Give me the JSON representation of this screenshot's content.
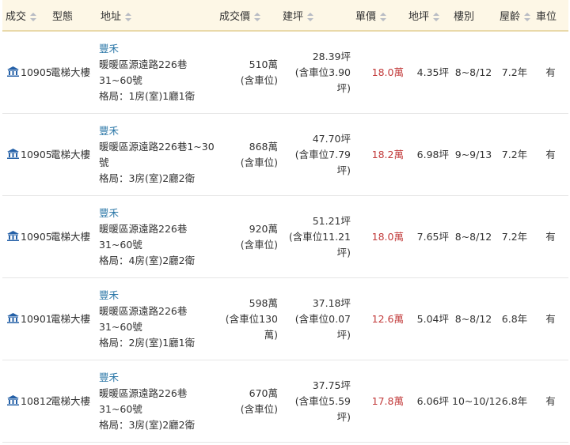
{
  "headers": [
    {
      "label": "成交",
      "sortable": true
    },
    {
      "label": "型態",
      "sortable": false
    },
    {
      "label": "地址",
      "sortable": true
    },
    {
      "label": "成交價",
      "sortable": true
    },
    {
      "label": "建坪",
      "sortable": true
    },
    {
      "label": "單價",
      "sortable": true
    },
    {
      "label": "地坪",
      "sortable": true
    },
    {
      "label": "樓別",
      "sortable": false
    },
    {
      "label": "屋齡",
      "sortable": true
    },
    {
      "label": "車位",
      "sortable": false
    }
  ],
  "rows": [
    {
      "date": "10905",
      "type": "電梯大樓",
      "community": "豐禾",
      "addr1": "暖暖區源遠路226巷",
      "addr2": "31~60號",
      "layout": "格局：1房(室)1廳1衛",
      "price1": "510萬",
      "price2": "(含車位)",
      "area1": "28.39坪",
      "area2": "(含車位3.90",
      "area3": "坪)",
      "unit": "18.0萬",
      "land": "4.35坪",
      "floor": "8~8/12",
      "age": "7.2年",
      "parking": "有"
    },
    {
      "date": "10905",
      "type": "電梯大樓",
      "community": "豐禾",
      "addr1": "暖暖區源遠路226巷1~30",
      "addr2": "號",
      "layout": "格局：3房(室)2廳2衛",
      "price1": "868萬",
      "price2": "(含車位)",
      "area1": "47.70坪",
      "area2": "(含車位7.79",
      "area3": "坪)",
      "unit": "18.2萬",
      "land": "6.98坪",
      "floor": "9~9/13",
      "age": "7.2年",
      "parking": "有"
    },
    {
      "date": "10905",
      "type": "電梯大樓",
      "community": "豐禾",
      "addr1": "暖暖區源遠路226巷",
      "addr2": "31~60號",
      "layout": "格局：4房(室)2廳2衛",
      "price1": "920萬",
      "price2": "(含車位)",
      "area1": "51.21坪",
      "area2": "(含車位11.21",
      "area3": "坪)",
      "unit": "18.0萬",
      "land": "7.65坪",
      "floor": "8~8/12",
      "age": "7.2年",
      "parking": "有"
    },
    {
      "date": "10901",
      "type": "電梯大樓",
      "community": "豐禾",
      "addr1": "暖暖區源遠路226巷",
      "addr2": "31~60號",
      "layout": "格局：2房(室)1廳1衛",
      "price1": "598萬",
      "price2": "(含車位130",
      "price3": "萬)",
      "area1": "37.18坪",
      "area2": "(含車位0.07",
      "area3": "坪)",
      "unit": "12.6萬",
      "land": "5.04坪",
      "floor": "8~8/12",
      "age": "6.8年",
      "parking": "有"
    },
    {
      "date": "10812",
      "type": "電梯大樓",
      "community": "豐禾",
      "addr1": "暖暖區源遠路226巷",
      "addr2": "31~60號",
      "layout": "格局：3房(室)2廳2衛",
      "price1": "670萬",
      "price2": "(含車位)",
      "area1": "37.75坪",
      "area2": "(含車位5.59",
      "area3": "坪)",
      "unit": "17.8萬",
      "land": "6.06坪",
      "floor": "10~10/12",
      "age": "6.8年",
      "parking": "有"
    }
  ]
}
